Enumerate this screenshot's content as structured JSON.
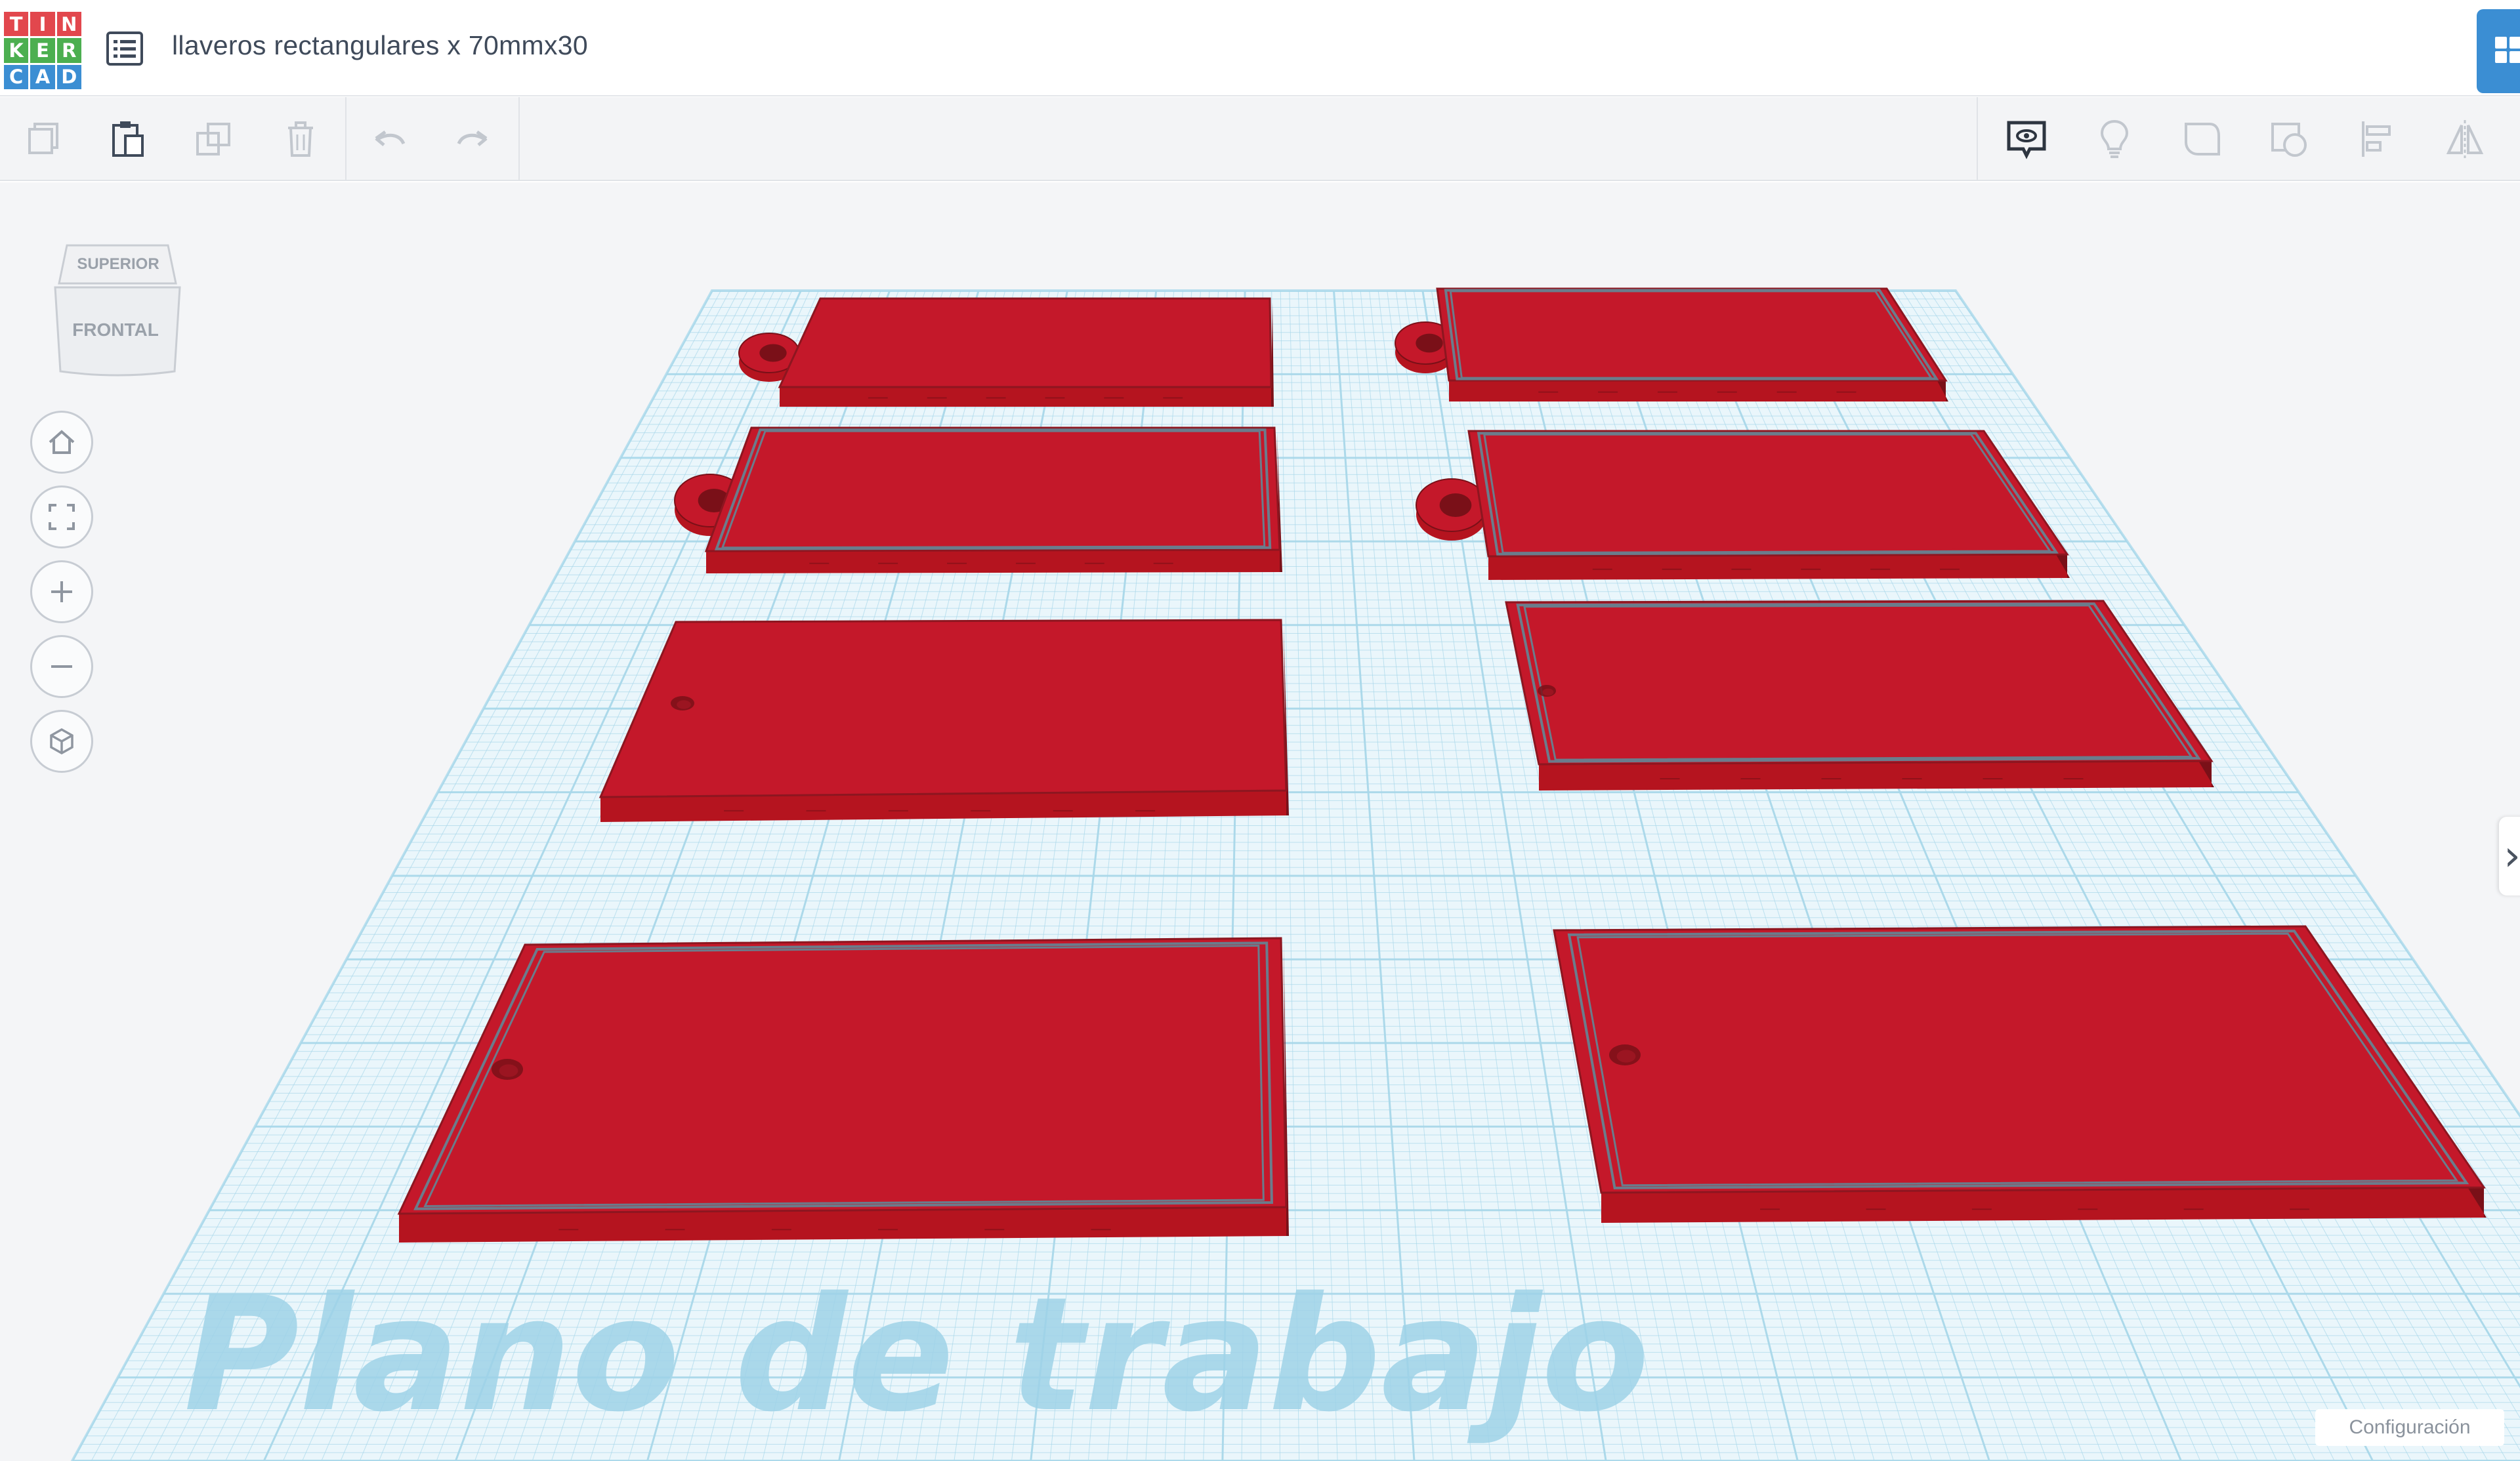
{
  "app": {
    "logo_letters": [
      "T",
      "I",
      "N",
      "K",
      "E",
      "R",
      "C",
      "A",
      "D"
    ],
    "logo_colors": [
      "#e2474d",
      "#e2474d",
      "#e2474d",
      "#4caf50",
      "#4caf50",
      "#4caf50",
      "#3b8ed3",
      "#3b8ed3",
      "#3b8ed3"
    ],
    "design_title": "llaveros rectangulares x 70mmx30"
  },
  "toolbar": {
    "left": [
      {
        "name": "copy-icon"
      },
      {
        "name": "paste-icon"
      },
      {
        "name": "duplicate-icon"
      },
      {
        "name": "delete-icon"
      },
      {
        "name": "undo-icon"
      },
      {
        "name": "redo-icon"
      }
    ],
    "right": [
      {
        "name": "notes-icon"
      },
      {
        "name": "show-all-icon"
      },
      {
        "name": "group-icon"
      },
      {
        "name": "ungroup-icon"
      },
      {
        "name": "align-icon"
      },
      {
        "name": "mirror-icon"
      }
    ]
  },
  "viewcube": {
    "top_label": "SUPERIOR",
    "front_label": "FRONTAL"
  },
  "nav": [
    "home-view-icon",
    "fit-all-icon",
    "zoom-in-icon",
    "zoom-out-icon",
    "perspective-icon"
  ],
  "workplane": {
    "label": "Plano de trabajo",
    "grid_color": "#a9d8ea",
    "shape_color": "#e01f2e"
  },
  "footer": {
    "settings_label": "Configuración"
  },
  "keychains": [
    {
      "name": "keychain-1",
      "side": "left",
      "has_tab": true
    },
    {
      "name": "keychain-2",
      "side": "right",
      "has_tab": true
    },
    {
      "name": "keychain-3",
      "side": "left",
      "has_tab": true
    },
    {
      "name": "keychain-4",
      "side": "right",
      "has_tab": true
    },
    {
      "name": "keychain-5",
      "side": "left",
      "has_hole": true
    },
    {
      "name": "keychain-6",
      "side": "right",
      "has_hole": true
    },
    {
      "name": "keychain-7",
      "side": "left",
      "has_hole": true
    },
    {
      "name": "keychain-8",
      "side": "right",
      "has_hole": true
    }
  ]
}
